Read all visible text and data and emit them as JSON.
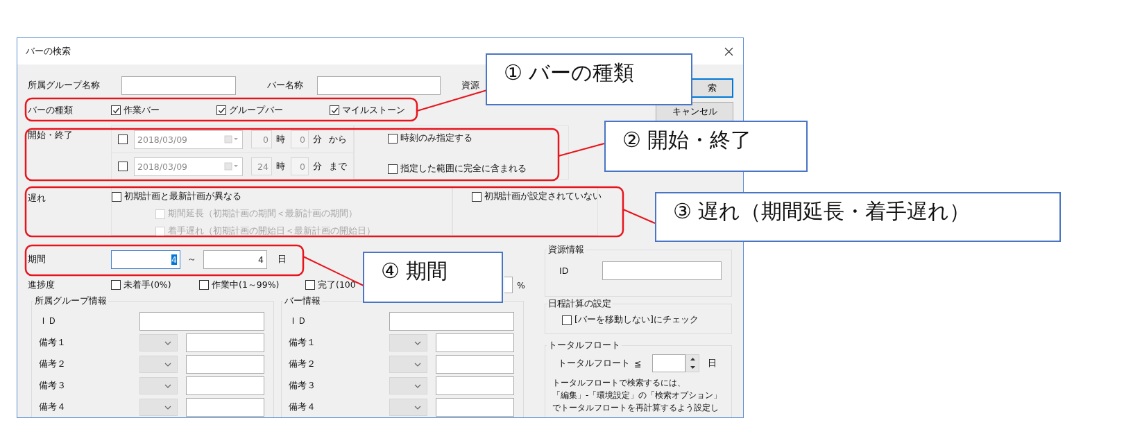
{
  "window": {
    "title": "バーの検索"
  },
  "name_row": {
    "group_name_label": "所属グループ名称",
    "bar_name_label": "バー名称",
    "resource_name_label": "資源"
  },
  "buttons": [
    {
      "label": "索",
      "kind": "default"
    },
    {
      "label": "キャンセル",
      "kind": "normal"
    }
  ],
  "bar_types": {
    "label": "バーの種類",
    "options": [
      {
        "label": "作業バー",
        "checked": true
      },
      {
        "label": "グループバー",
        "checked": true
      },
      {
        "label": "マイルストーン",
        "checked": true
      }
    ]
  },
  "start_end": {
    "label": "開始・終了",
    "rows": [
      {
        "checked": false,
        "date": "2018/03/09",
        "hour": "0",
        "hour_unit": "時",
        "minute": "0",
        "minute_unit": "分",
        "suffix": "から"
      },
      {
        "checked": false,
        "date": "2018/03/09",
        "hour": "24",
        "hour_unit": "時",
        "minute": "0",
        "minute_unit": "分",
        "suffix": "まで"
      }
    ],
    "options": [
      {
        "label": "時刻のみ指定する",
        "checked": false
      },
      {
        "label": "指定した範囲に完全に含まれる",
        "checked": false
      }
    ]
  },
  "delay": {
    "label": "遅れ",
    "options": [
      {
        "label": "初期計画と最新計画が異なる",
        "checked": false,
        "disabled": false
      },
      {
        "label": "期間延長（初期計画の期間＜最新計画の期間）",
        "checked": false,
        "disabled": true
      },
      {
        "label": "着手遅れ（初期計画の開始日＜最新計画の開始日）",
        "checked": false,
        "disabled": true
      }
    ],
    "unset": {
      "label": "初期計画が設定されていない",
      "checked": false
    }
  },
  "period": {
    "label": "期間",
    "from": "4",
    "from_selected": true,
    "separator": "～",
    "to": "4",
    "unit": "日"
  },
  "progress": {
    "label": "進捗度",
    "options": [
      {
        "label": "未着手(0%)",
        "checked": false
      },
      {
        "label": "作業中(1～99%)",
        "checked": false
      },
      {
        "label": "完了(100",
        "checked": false
      }
    ],
    "percent_unit": "%"
  },
  "group_info": {
    "title": "所属グループ情報",
    "id_label": "ＩＤ",
    "notes": [
      "備考１",
      "備考２",
      "備考３",
      "備考４"
    ]
  },
  "bar_info": {
    "title": "バー情報",
    "id_label": "ＩＤ",
    "notes": [
      "備考１",
      "備考２",
      "備考３",
      "備考４"
    ]
  },
  "resource_info": {
    "title": "資源情報",
    "id_label": "ID"
  },
  "schedule": {
    "title": "日程計算の設定",
    "option": {
      "label": "[バーを移動しない]にチェック",
      "checked": false
    }
  },
  "total_float": {
    "title": "トータルフロート",
    "label": "トータルフロート",
    "operator": "≦",
    "unit": "日",
    "note_lines": [
      "トータルフロートで検索するには、",
      "「編集」-「環境設定」の「検索オプション」",
      "でトータルフロートを再計算するよう設定し"
    ]
  },
  "annotations": [
    {
      "text": "① バーの種類"
    },
    {
      "text": "② 開始・終了"
    },
    {
      "text": "③ 遅れ（期間延長・着手遅れ）"
    },
    {
      "text": "④ 期間"
    }
  ]
}
